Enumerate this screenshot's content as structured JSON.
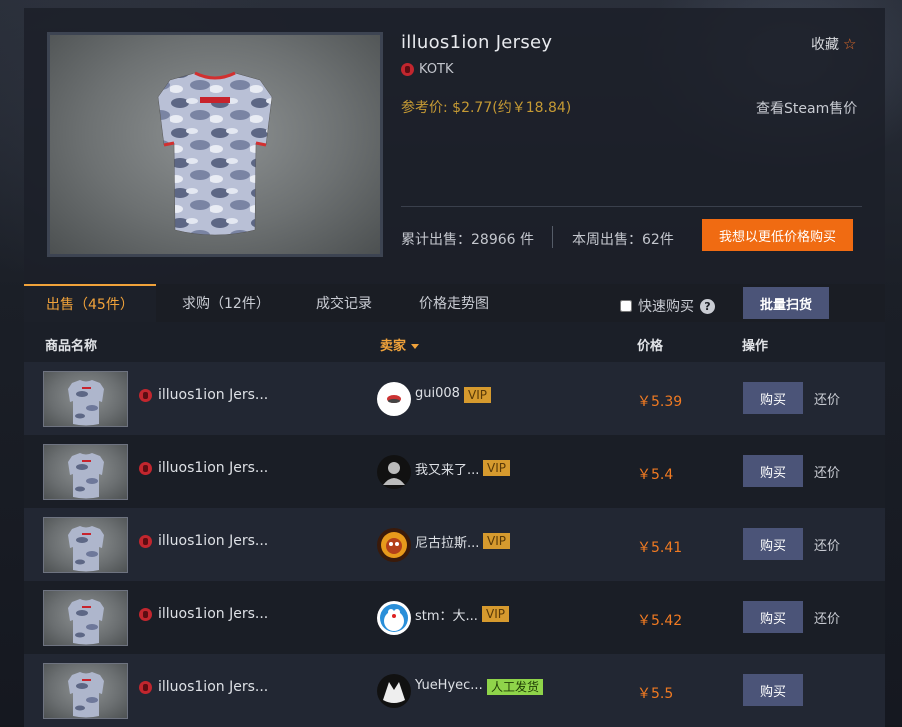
{
  "item": {
    "title": "illuos1ion Jersey",
    "team": "KOTK",
    "ref_price": "参考价: $2.77(约￥18.84)",
    "favorite_label": "收藏",
    "steam_price_link": "查看Steam售价",
    "total_sold": "累计出售：28966 件",
    "week_sold": "本周出售：62件",
    "buy_lower_label": "我想以更低价格购买"
  },
  "colors": {
    "accent": "#f0a23a",
    "orange_button": "#f06b12",
    "price": "#f07a22",
    "vip": "#d69a2e",
    "manual": "#8fd44a",
    "button": "#4b5478"
  },
  "tabs": [
    {
      "label": "出售（45件）",
      "active": true
    },
    {
      "label": "求购（12件）"
    },
    {
      "label": "成交记录"
    },
    {
      "label": "价格走势图"
    }
  ],
  "quick_buy_label": "快速购买",
  "bulk_buy_label": "批量扫货",
  "table": {
    "headers": {
      "name": "商品名称",
      "seller": "卖家",
      "price": "价格",
      "action": "操作"
    },
    "rows": [
      {
        "name": "illuos1ion Jers...",
        "seller": "gui008",
        "badge": "VIP",
        "price": "￥5.39",
        "buy": "购买",
        "counter": "还价",
        "avatar": "white-logo"
      },
      {
        "name": "illuos1ion Jers...",
        "seller": "我又来了...",
        "badge": "VIP",
        "price": "￥5.4",
        "buy": "购买",
        "counter": "还价",
        "avatar": "default-user"
      },
      {
        "name": "illuos1ion Jers...",
        "seller": "尼古拉斯...",
        "badge": "VIP",
        "price": "￥5.41",
        "buy": "购买",
        "counter": "还价",
        "avatar": "fire-face"
      },
      {
        "name": "illuos1ion Jers...",
        "seller": "stm：大...",
        "badge": "VIP",
        "price": "￥5.42",
        "buy": "购买",
        "counter": "还价",
        "avatar": "doraemon"
      },
      {
        "name": "illuos1ion Jers...",
        "seller": "YueHyec...",
        "badge": "人工发货",
        "price": "￥5.5",
        "buy": "购买",
        "counter": "",
        "avatar": "wolf"
      }
    ]
  }
}
